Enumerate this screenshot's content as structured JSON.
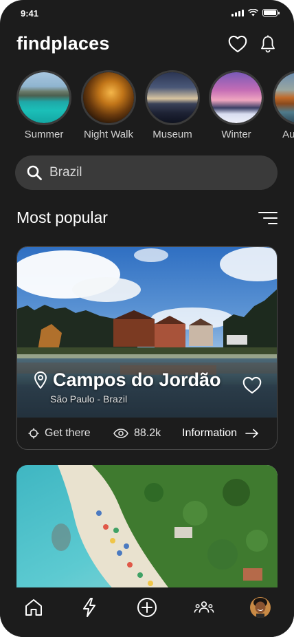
{
  "status_bar": {
    "time": "9:41"
  },
  "header": {
    "app_name": "findplaces"
  },
  "stories": [
    {
      "label": "Summer"
    },
    {
      "label": "Night Walk"
    },
    {
      "label": "Museum"
    },
    {
      "label": "Winter"
    },
    {
      "label": "Autumn"
    }
  ],
  "search": {
    "value": "Brazil"
  },
  "section": {
    "title": "Most popular"
  },
  "featured_card": {
    "title": "Campos do Jordão",
    "subtitle": "São Paulo - Brazil",
    "action_get_there": "Get there",
    "views": "88.2k",
    "info_label": "Information"
  },
  "tabbar": {
    "items": [
      "home",
      "flash",
      "add",
      "community",
      "profile"
    ]
  },
  "colors": {
    "background": "#1c1c1c",
    "search_bg": "#3a3a3a",
    "text": "#ffffff"
  }
}
